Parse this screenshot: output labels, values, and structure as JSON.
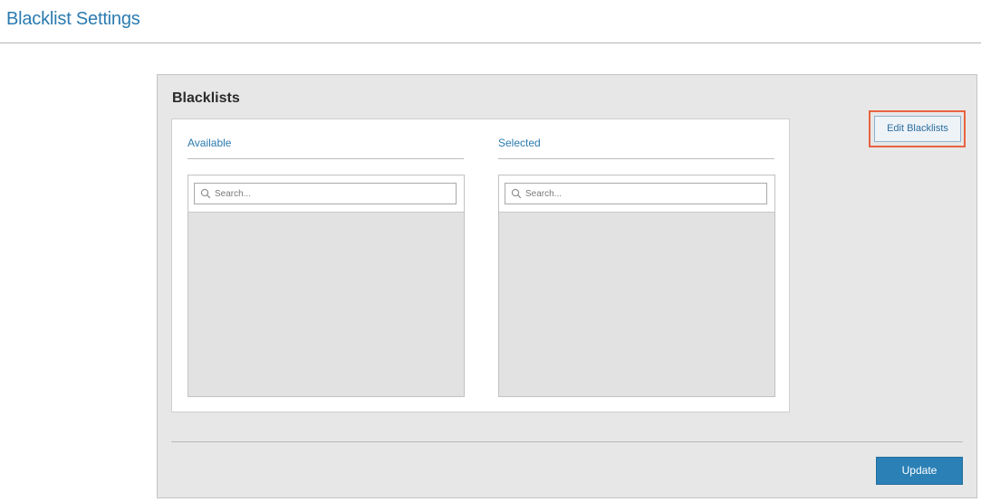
{
  "page": {
    "title": "Blacklist Settings"
  },
  "panel": {
    "title": "Blacklists",
    "edit_button_label": "Edit Blacklists",
    "update_button_label": "Update"
  },
  "lists": {
    "available": {
      "label": "Available",
      "search_placeholder": "Search..."
    },
    "selected": {
      "label": "Selected",
      "search_placeholder": "Search..."
    }
  },
  "colors": {
    "accent": "#2b7bb0",
    "highlight": "#e8633f",
    "update_button": "#2b80b6"
  }
}
